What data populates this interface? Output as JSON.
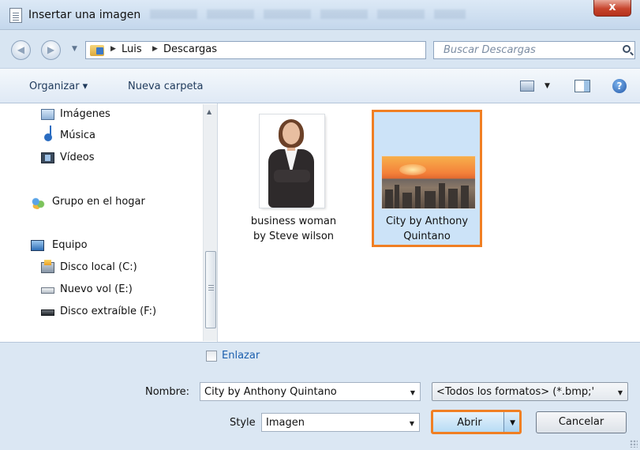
{
  "window": {
    "title": "Insertar una imagen",
    "close_glyph": "x"
  },
  "address": {
    "crumbs": [
      "Luis",
      "Descargas"
    ],
    "search_placeholder": "Buscar Descargas"
  },
  "toolbar": {
    "organize": "Organizar ▾",
    "new_folder": "Nueva carpeta"
  },
  "nav": {
    "items": [
      {
        "label": "Imágenes",
        "icon": "images-library-icon"
      },
      {
        "label": "Música",
        "icon": "music-note-icon"
      },
      {
        "label": "Vídeos",
        "icon": "video-film-icon"
      },
      {
        "label": "Grupo en el hogar",
        "icon": "homegroup-icon"
      },
      {
        "label": "Equipo",
        "icon": "computer-icon"
      },
      {
        "label": "Disco local (C:)",
        "icon": "local-disk-icon"
      },
      {
        "label": "Nuevo vol (E:)",
        "icon": "drive-icon"
      },
      {
        "label": "Disco extraíble (F:)",
        "icon": "removable-disk-icon"
      }
    ]
  },
  "files": [
    {
      "name_line1": "business woman",
      "name_line2": "by Steve wilson",
      "selected": false
    },
    {
      "name_line1": "City by Anthony",
      "name_line2": "Quintano",
      "selected": true
    }
  ],
  "bottom": {
    "link_label": "Enlazar",
    "filename_label": "Nombre:",
    "filename_value": "City by Anthony Quintano",
    "filetype_value": "<Todos los formatos> (*.bmp;'",
    "style_label": "Style",
    "style_value": "Imagen",
    "open_button": "Abrir",
    "cancel_button": "Cancelar"
  },
  "colors": {
    "highlight": "#f07f23",
    "selection": "#cce3f8",
    "link": "#1b5fae"
  }
}
